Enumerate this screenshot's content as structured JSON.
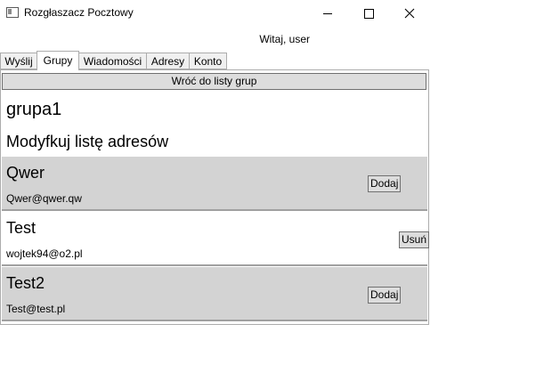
{
  "window": {
    "title": "Rozgłaszacz Pocztowy",
    "greeting": "Witaj, user"
  },
  "tabs": [
    {
      "label": "Wyślij",
      "active": false
    },
    {
      "label": "Grupy",
      "active": true
    },
    {
      "label": "Wiadomości",
      "active": false
    },
    {
      "label": "Adresy",
      "active": false
    },
    {
      "label": "Konto",
      "active": false
    }
  ],
  "groups_view": {
    "back_button": "Wróć do listy grup",
    "group_name": "grupa1",
    "section_title": "Modyfkuj listę adresów",
    "addresses": [
      {
        "name": "Qwer",
        "email": "Qwer@qwer.qw",
        "action": "Dodaj",
        "in_group": false
      },
      {
        "name": "Test",
        "email": "wojtek94@o2.pl",
        "action": "Usuń",
        "in_group": true
      },
      {
        "name": "Test2",
        "email": "Test@test.pl",
        "action": "Dodaj",
        "in_group": false
      }
    ]
  },
  "colors": {
    "row_shaded": "#d3d3d3",
    "button_bg": "#dddddd"
  }
}
